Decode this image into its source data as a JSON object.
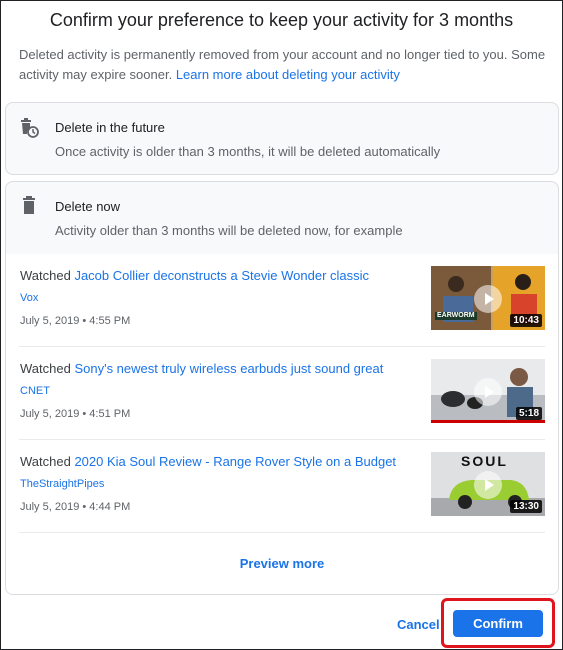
{
  "dialog": {
    "title": "Confirm your preference to keep your activity for 3 months",
    "intro_text": "Deleted activity is permanently removed from your account and no longer tied to you. Some activity may expire sooner.",
    "intro_link": "Learn more about deleting your activity"
  },
  "future_card": {
    "title": "Delete in the future",
    "description": "Once activity is older than 3 months, it will be deleted automatically",
    "icon": "trash-clock-icon"
  },
  "now_card": {
    "title": "Delete now",
    "description": "Activity older than 3 months will be deleted now, for example",
    "icon": "trash-icon"
  },
  "activity_items": [
    {
      "prefix": "Watched",
      "title": "Jacob Collier deconstructs a Stevie Wonder classic",
      "channel": "Vox",
      "date": "July 5, 2019 • 4:55 PM",
      "duration": "10:43",
      "thumb_text": "EARWORM"
    },
    {
      "prefix": "Watched",
      "title": "Sony's newest truly wireless earbuds just sound great",
      "channel": "CNET",
      "date": "July 5, 2019 • 4:51 PM",
      "duration": "5:18"
    },
    {
      "prefix": "Watched",
      "title": "2020 Kia Soul Review - Range Rover Style on a Budget",
      "channel": "TheStraightPipes",
      "date": "July 5, 2019 • 4:44 PM",
      "duration": "13:30",
      "thumb_text": "SOUL"
    }
  ],
  "preview_more_label": "Preview more",
  "footer": {
    "cancel_label": "Cancel",
    "confirm_label": "Confirm"
  },
  "colors": {
    "accent": "#1a73e8",
    "highlight": "#e0141c"
  }
}
